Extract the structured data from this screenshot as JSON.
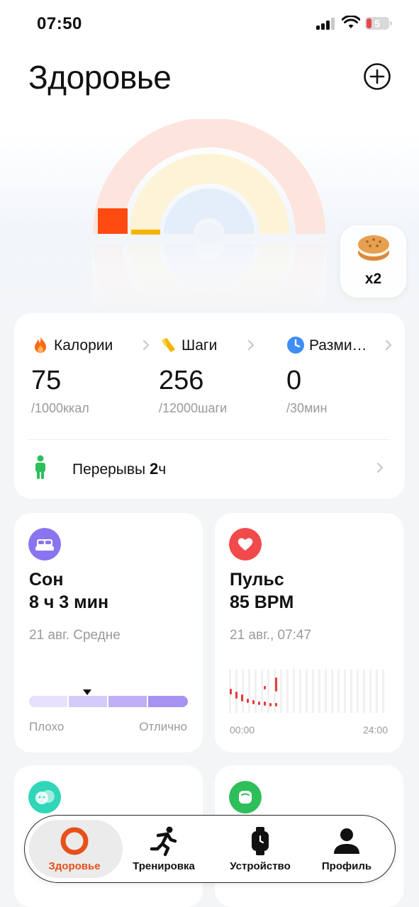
{
  "status_bar": {
    "time": "07:50",
    "battery": "5"
  },
  "page": {
    "title": "Здоровье"
  },
  "cookie": {
    "count": "x2"
  },
  "activity": {
    "metrics": [
      {
        "label": "Калории",
        "value": "75",
        "goal": "/1000ккал",
        "color": "#ff6a13"
      },
      {
        "label": "Шаги",
        "value": "256",
        "goal": "/12000шаги",
        "color": "#f5b400"
      },
      {
        "label": "Разми…",
        "value": "0",
        "goal": "/30мин",
        "color": "#3f8ef5"
      }
    ],
    "breaks": {
      "label": "Перерывы",
      "value": "2",
      "unit": "ч",
      "color": "#2fbf5a"
    }
  },
  "sleep": {
    "title": "Сон",
    "value": "8 ч 3 мин",
    "date": "21 авг. Средне",
    "low_label": "Плохо",
    "high_label": "Отлично",
    "level_segment": 2,
    "color": "#8a74f0"
  },
  "pulse": {
    "title": "Пульс",
    "value": "85 BPM",
    "date": "21 авг., 07:47",
    "x_start": "00:00",
    "x_end": "24:00",
    "color": "#f24a4a"
  },
  "tabs": [
    {
      "label": "Здоровье",
      "active": true
    },
    {
      "label": "Тренировка",
      "active": false
    },
    {
      "label": "Устройство",
      "active": false
    },
    {
      "label": "Профиль",
      "active": false
    }
  ]
}
